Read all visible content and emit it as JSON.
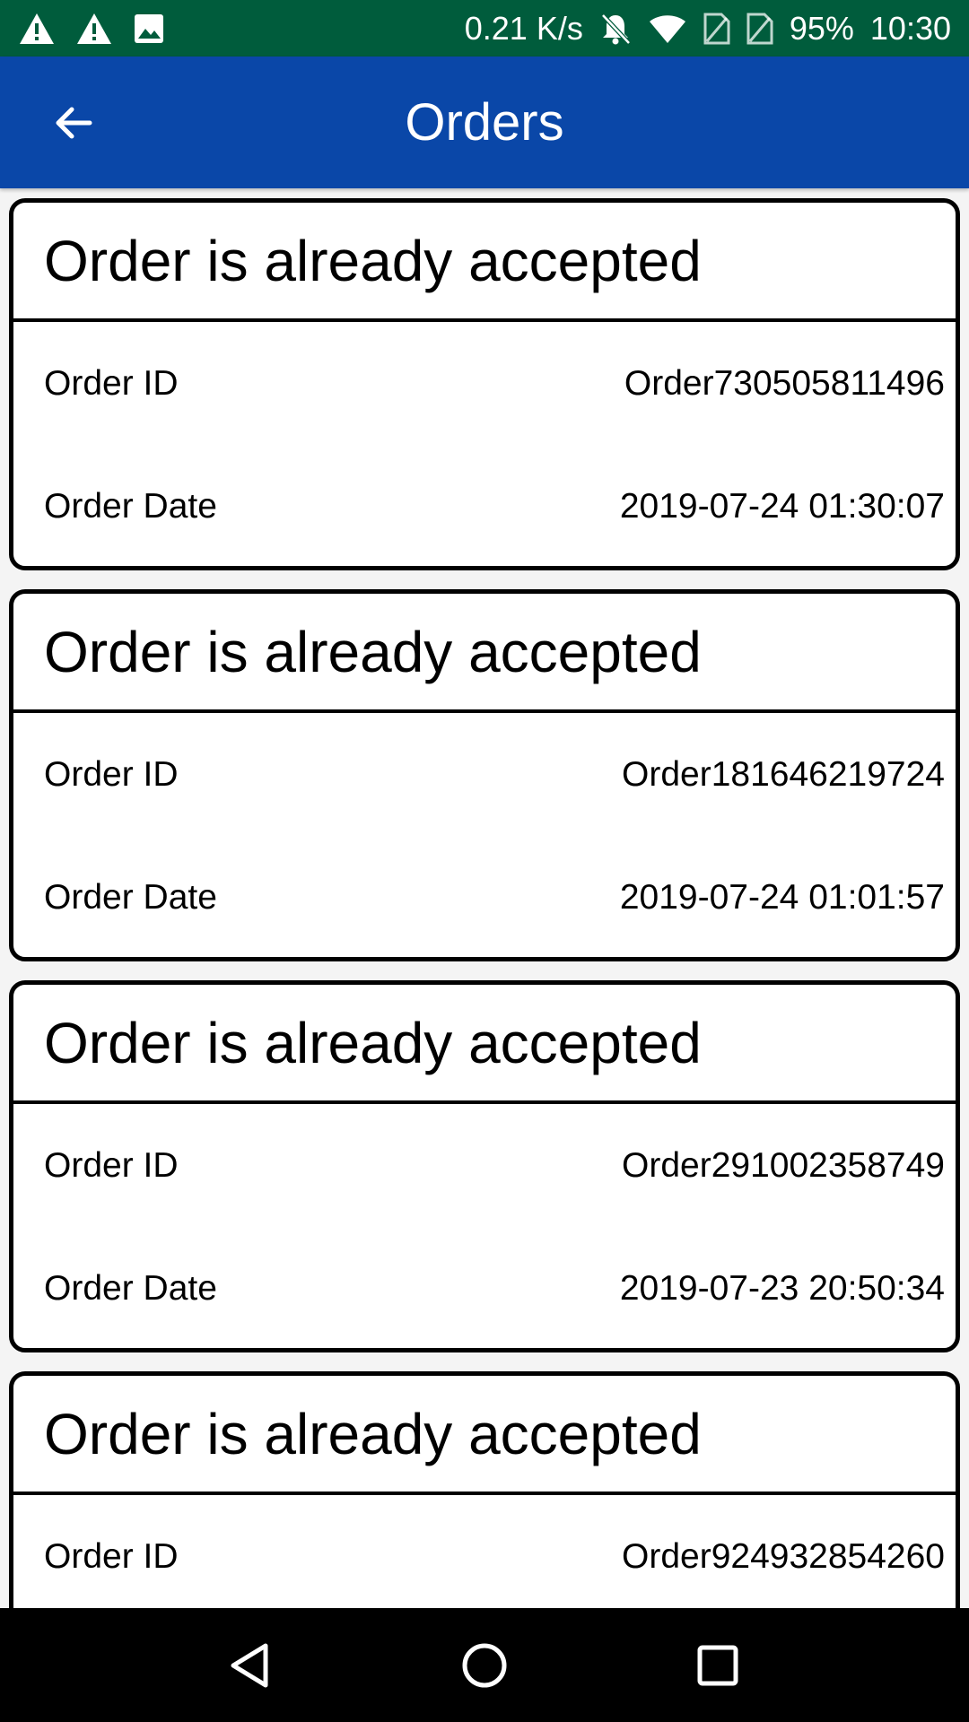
{
  "status_bar": {
    "net_speed": "0.21 K/s",
    "battery": "95%",
    "time": "10:30",
    "icons": [
      "warning-icon",
      "warning-icon",
      "image-icon",
      "bell-off-icon",
      "wifi-icon",
      "no-sim-icon",
      "no-sim-icon"
    ]
  },
  "header": {
    "title": "Orders",
    "back_icon": "arrow-left-icon"
  },
  "colors": {
    "status_bar": "#005c3c",
    "app_bar": "#0a47a8",
    "background": "#f4f4f4",
    "card_border": "#000000"
  },
  "orders": [
    {
      "status": "Order is already accepted",
      "id_label": "Order ID",
      "id_value": "Order730505811496",
      "date_label": "Order Date",
      "date_value": "2019-07-24 01:30:07"
    },
    {
      "status": "Order is already accepted",
      "id_label": "Order ID",
      "id_value": "Order181646219724",
      "date_label": "Order Date",
      "date_value": "2019-07-24 01:01:57"
    },
    {
      "status": "Order is already accepted",
      "id_label": "Order ID",
      "id_value": "Order291002358749",
      "date_label": "Order Date",
      "date_value": "2019-07-23 20:50:34"
    },
    {
      "status": "Order is already accepted",
      "id_label": "Order ID",
      "id_value": "Order924932854260",
      "date_label": "Order Date",
      "date_value": ""
    }
  ],
  "nav": {
    "icons": [
      "back-triangle-icon",
      "home-circle-icon",
      "recents-square-icon"
    ]
  }
}
